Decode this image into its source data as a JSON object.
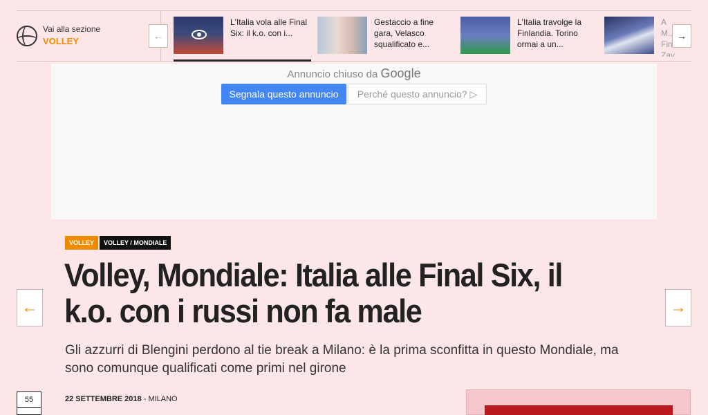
{
  "section": {
    "prefix": "Vai alla sezione",
    "name": "VOLLEY",
    "icon": "volleyball-icon"
  },
  "news_strip": {
    "items": [
      {
        "title": "L'Italia vola alle Final Six: il k.o. con i...",
        "thumb_color": "#3b4a7a",
        "has_video": true
      },
      {
        "title": "Gestaccio a fine gara, Velasco squalificato e...",
        "thumb_color": "#c9b8b3"
      },
      {
        "title": "L'Italia travolge la Finlandia. Torino ormai a un...",
        "thumb_color": "#5b6fb0"
      },
      {
        "title": "A M... Fin... Zay...",
        "thumb_color": "#2f3d6e"
      }
    ],
    "prev_icon": "←",
    "next_icon": "→"
  },
  "ad": {
    "closed_text": "Annuncio chiuso da",
    "closed_brand": "Google",
    "report_label": "Segnala questo annuncio",
    "why_label": "Perché questo annuncio? ▷"
  },
  "article": {
    "tags": [
      "VOLLEY",
      "VOLLEY / MONDIALE"
    ],
    "headline": "Volley, Mondiale: Italia alle Final Six, il k.o. con i russi non fa male",
    "subtitle": "Gli azzurri di Blengini perdono al tie break a Milano: è la prima sconfitta in questo Mondiale, ma sono comunque qualificati come primi nel girone",
    "date": "22 SETTEMBRE 2018",
    "location": "- MILANO",
    "share_count": "55"
  },
  "nav": {
    "prev_icon": "←",
    "next_icon": "→"
  },
  "colors": {
    "accent": "#f08a00",
    "background": "#fde6e8",
    "ad_button": "#4285f4"
  }
}
